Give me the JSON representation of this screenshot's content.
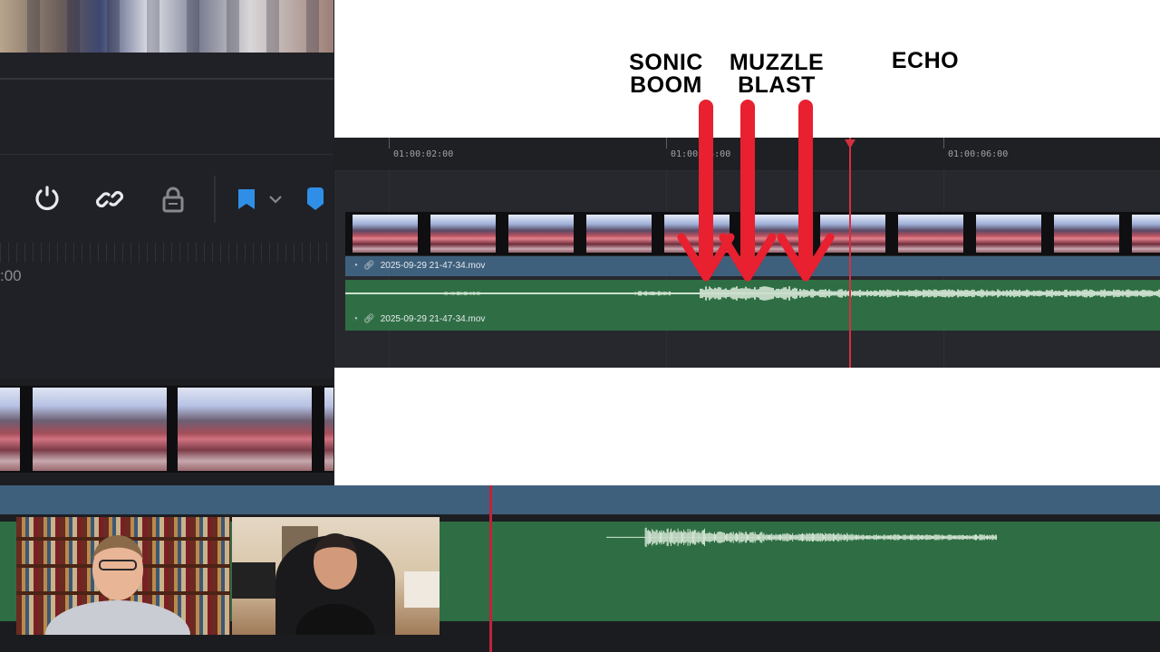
{
  "annotations": {
    "sonic_boom": "SONIC\nBOOM",
    "muzzle_blast": "MUZZLE\nBLAST",
    "echo": "ECHO"
  },
  "timeline": {
    "timecodes": [
      "01:00:02:00",
      "01:00:04:00",
      "01:00:06:00"
    ],
    "video_clip_name": "2025-09-29 21-47-34.mov",
    "audio_clip_name": "2025-09-29 21-47-34.mov"
  },
  "background_editor": {
    "timecode_fragment": ":00"
  },
  "icons": {
    "snap": "magnet-icon",
    "link": "link-icon",
    "lock": "lock-icon",
    "flag": "flag-icon",
    "dropdown": "chevron-down-icon",
    "marker": "marker-icon",
    "speed": "speed-icon",
    "clip_link": "link-icon"
  },
  "colors": {
    "arrow_red": "#e8202f",
    "playhead_red": "#d43040",
    "audio_green": "#2f6e44",
    "video_blue": "#3e607c",
    "flag_blue": "#2f8fe6"
  }
}
